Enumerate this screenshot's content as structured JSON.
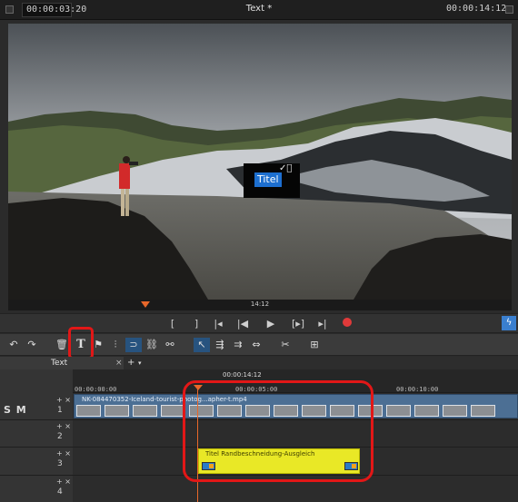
{
  "window": {
    "title": "Text *",
    "timecode_left": "00:00:03:20",
    "timecode_right": "00:00:14:12"
  },
  "preview": {
    "title_text": "Titel",
    "title_icons": "✓⃠",
    "position_time": "14:12"
  },
  "transport": {
    "mark_in": "[",
    "mark_out": "]",
    "prev_marker": "|◂",
    "back": "|◀",
    "play": "▶",
    "next_frame": "[▸]",
    "next_marker": "▸|",
    "flash": "ϟ"
  },
  "toolbar": {
    "undo": "↶",
    "redo": "↷",
    "delete": "🗑",
    "text": "T",
    "marker": "⚑",
    "split": "⫶",
    "magnet": "⊃",
    "link": "⛓",
    "unlink": "⚯",
    "pointer": "↖",
    "trim_mode": "⇶",
    "slip": "⇉",
    "range": "⇔",
    "cut": "✂",
    "insert": "⊞"
  },
  "tabs": [
    {
      "label": "Text",
      "close": "×"
    }
  ],
  "tab_add": "+",
  "tab_menu": "▾",
  "timeline": {
    "top_time": "00:00:14:12",
    "ruler_labels": [
      "00:00:00:00",
      "00:00:05:00",
      "00:00:10:00"
    ],
    "track_header_left": "S M",
    "track_controls": "+ ×",
    "tracks": [
      {
        "number": "1"
      },
      {
        "number": "2"
      },
      {
        "number": "3"
      },
      {
        "number": "4"
      }
    ],
    "video_clip_label": "NK-084470352-Iceland-tourist-photog...apher-t.mp4",
    "title_clip_label": "Titel   Randbeschneidung-Ausgleich"
  },
  "colors": {
    "accent": "#1d6fd0",
    "playhead": "#e8672a",
    "title_clip": "#e9e826",
    "video_clip": "#4c6f94",
    "highlight_annotation": "#e21717"
  }
}
